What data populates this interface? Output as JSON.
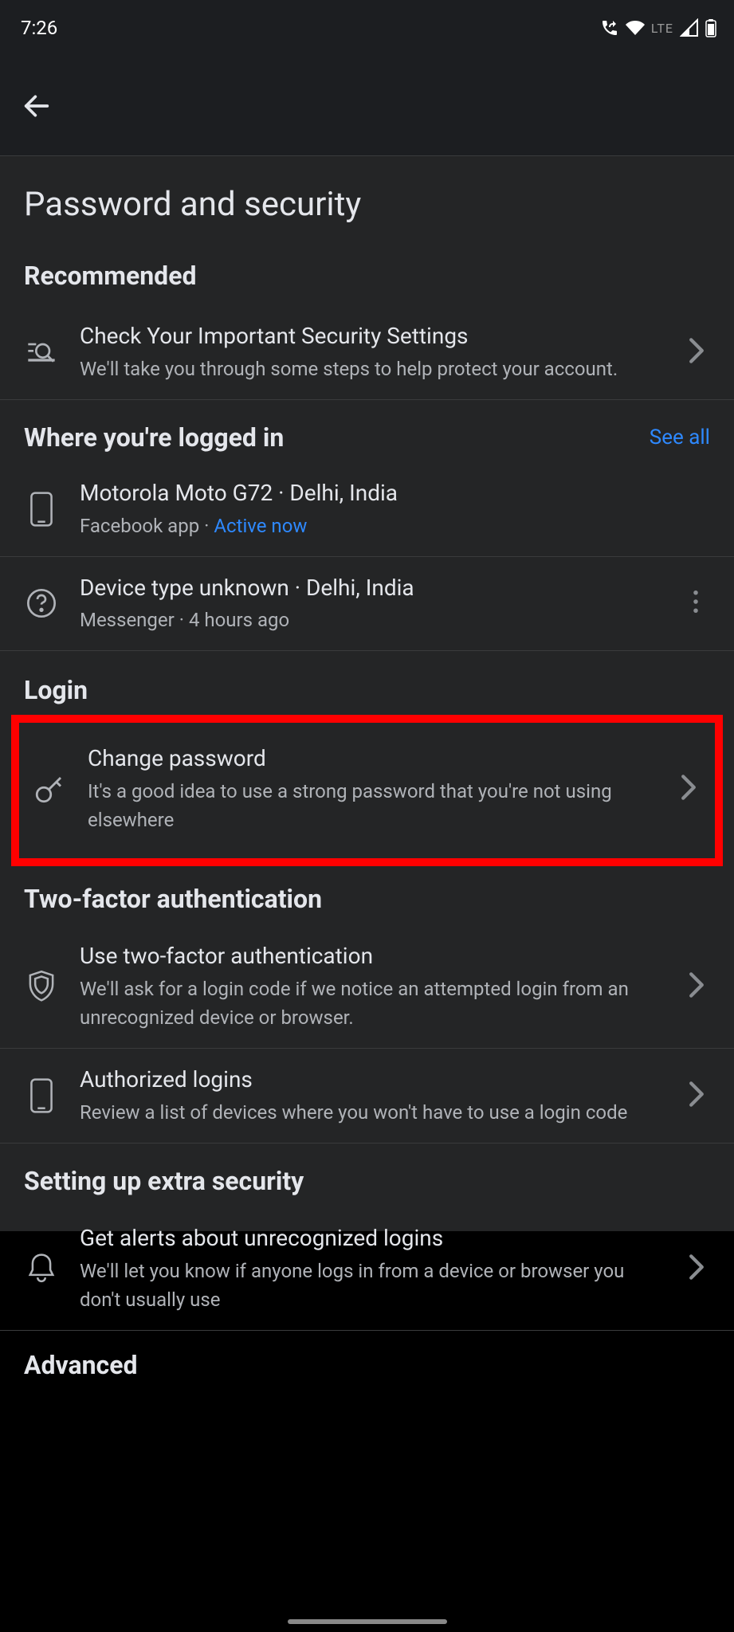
{
  "statusbar": {
    "time": "7:26",
    "lte": "LTE"
  },
  "page": {
    "title": "Password and security"
  },
  "sections": {
    "recommended": {
      "header": "Recommended",
      "item": {
        "title": "Check Your Important Security Settings",
        "subtitle": "We'll take you through some steps to help protect your account."
      }
    },
    "logged_in": {
      "header": "Where you're logged in",
      "see_all": "See all",
      "devices": [
        {
          "title": "Motorola Moto G72 · Delhi, India",
          "app": "Facebook app · ",
          "status": "Active now"
        },
        {
          "title": "Device type unknown · Delhi, India",
          "subtitle": "Messenger · 4 hours ago"
        }
      ]
    },
    "login": {
      "header": "Login",
      "change_password": {
        "title": "Change password",
        "subtitle": "It's a good idea to use a strong password that you're not using elsewhere"
      }
    },
    "two_factor": {
      "header": "Two-factor authentication",
      "use_tfa": {
        "title": "Use two-factor authentication",
        "subtitle": "We'll ask for a login code if we notice an attempted login from an unrecognized device or browser."
      },
      "authorized": {
        "title": "Authorized logins",
        "subtitle": "Review a list of devices where you won't have to use a login code"
      }
    },
    "extra_security": {
      "header": "Setting up extra security",
      "alerts": {
        "title": "Get alerts about unrecognized logins",
        "subtitle": "We'll let you know if anyone logs in from a device or browser you don't usually use"
      }
    },
    "advanced": {
      "header": "Advanced"
    }
  }
}
